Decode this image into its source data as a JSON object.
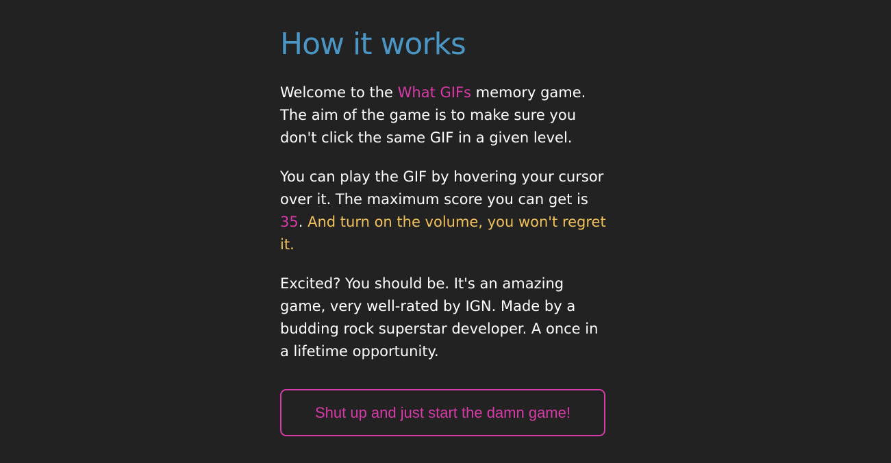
{
  "heading": "How it works",
  "colors": {
    "background": "#222222",
    "heading": "#4b96c4",
    "accent_pink": "#d83ba8",
    "accent_yellow": "#f0c05a",
    "text": "#ffffff"
  },
  "para1": {
    "before": "Welcome to the ",
    "game_name": "What GIFs",
    "after": " memory game. The aim of the game is to make sure you don't click the same GIF in a given level."
  },
  "para2": {
    "before": "You can play the GIF by hovering your cursor over it. The maximum score you can get is ",
    "max_score": "35",
    "period": ".",
    "highlight": " And turn on the volume, you won't regret it."
  },
  "para3": "Excited? You should be. It's an amazing game, very well-rated by IGN. Made by a budding rock superstar developer. A once in a lifetime opportunity.",
  "start_button_label": "Shut up and just start the damn game!"
}
